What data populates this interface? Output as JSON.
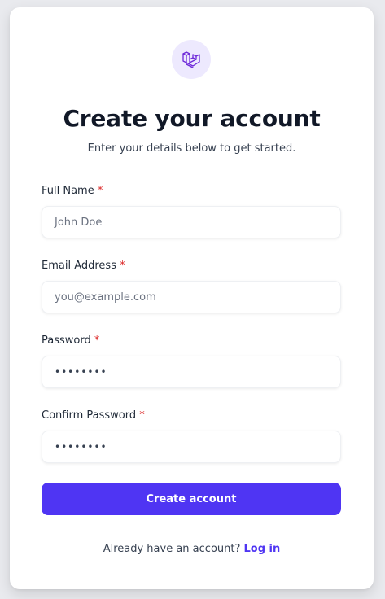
{
  "logo": {
    "icon": "laravel-icon",
    "accent": "#6d28d9",
    "badge_bg": "#ede9fe"
  },
  "header": {
    "title": "Create your account",
    "subtitle": "Enter your details below to get started."
  },
  "form": {
    "full_name": {
      "label": "Full Name",
      "required": "*",
      "placeholder": "John Doe",
      "value": ""
    },
    "email": {
      "label": "Email Address",
      "required": "*",
      "placeholder": "you@example.com",
      "value": ""
    },
    "password": {
      "label": "Password",
      "required": "*",
      "value": "••••••••"
    },
    "confirm_password": {
      "label": "Confirm Password",
      "required": "*",
      "value": "••••••••"
    },
    "submit_label": "Create account"
  },
  "footer": {
    "prompt": "Already have an account?",
    "login_link": "Log in"
  },
  "colors": {
    "primary": "#4f35f3",
    "required": "#dc2626"
  }
}
